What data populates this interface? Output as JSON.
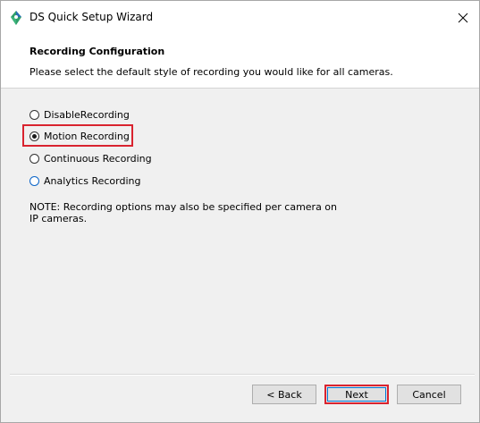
{
  "window": {
    "title": "DS Quick Setup Wizard"
  },
  "header": {
    "title": "Recording Configuration",
    "subtitle": "Please select the default style of recording you would like for all cameras."
  },
  "options": [
    {
      "label": "DisableRecording",
      "selected": false
    },
    {
      "label": "Motion Recording",
      "selected": true
    },
    {
      "label": "Continuous Recording",
      "selected": false
    },
    {
      "label": "Analytics Recording",
      "selected": false
    }
  ],
  "note": "NOTE: Recording options may also be specified per camera on IP cameras.",
  "buttons": {
    "back": "< Back",
    "next": "Next",
    "cancel": "Cancel"
  },
  "colors": {
    "highlight": "#d9232f",
    "focus": "#0a64c8",
    "icon_green": "#2e9e6a",
    "icon_blue": "#2a6db5"
  }
}
